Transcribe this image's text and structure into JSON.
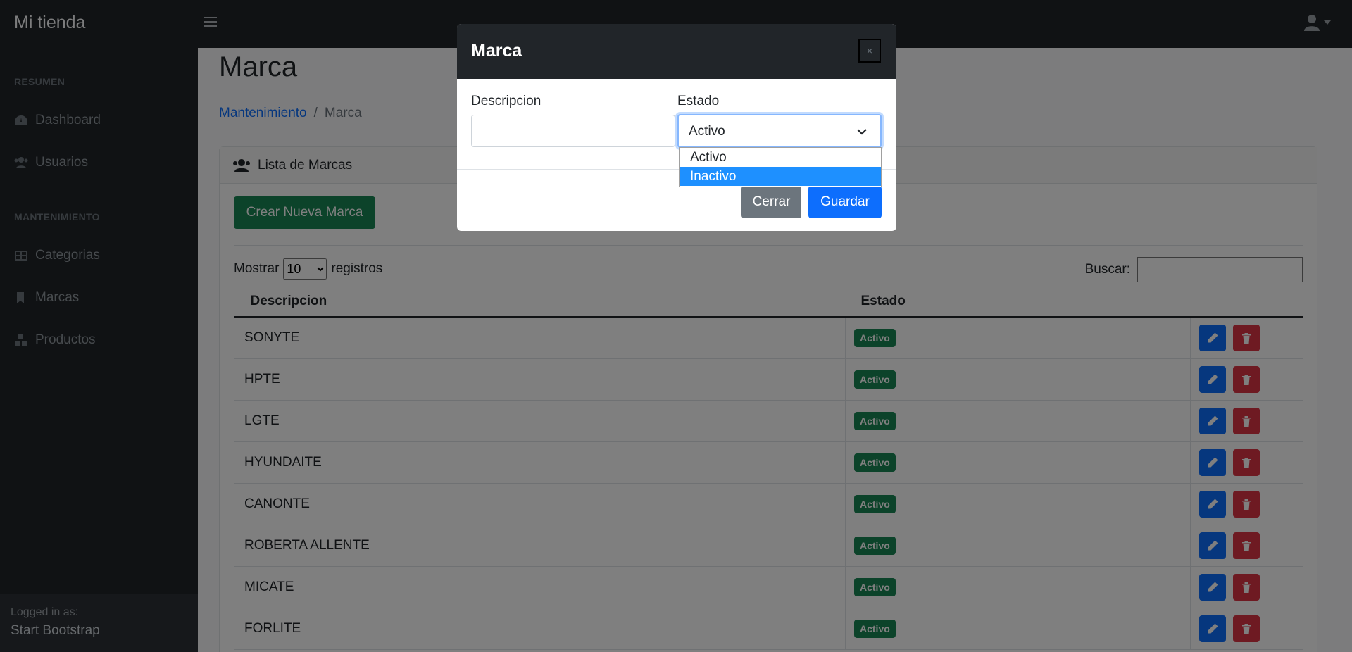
{
  "navbar": {
    "brand": "Mi tienda"
  },
  "sidebar": {
    "heading_resumen": "RESUMEN",
    "heading_mantenimiento": "MANTENIMIENTO",
    "items": [
      {
        "label": "Dashboard",
        "icon": "tachometer-icon"
      },
      {
        "label": "Usuarios",
        "icon": "users-icon"
      },
      {
        "label": "Categorias",
        "icon": "table-icon"
      },
      {
        "label": "Marcas",
        "icon": "bookmark-icon"
      },
      {
        "label": "Productos",
        "icon": "boxes-icon"
      }
    ],
    "footer": {
      "logged_in_label": "Logged in as:",
      "user": "Start Bootstrap"
    }
  },
  "page": {
    "title": "Marca",
    "breadcrumb": {
      "parent": "Mantenimiento",
      "separator": "/",
      "current": "Marca"
    },
    "card_title": "Lista de Marcas",
    "new_button": "Crear Nueva Marca",
    "length": {
      "prefix": "Mostrar",
      "value": "10",
      "suffix": "registros"
    },
    "search_label": "Buscar:"
  },
  "table": {
    "columns": [
      "Descripcion",
      "Estado",
      ""
    ],
    "rows": [
      {
        "descripcion": "SONYTE",
        "estado": "Activo"
      },
      {
        "descripcion": "HPTE",
        "estado": "Activo"
      },
      {
        "descripcion": "LGTE",
        "estado": "Activo"
      },
      {
        "descripcion": "HYUNDAITE",
        "estado": "Activo"
      },
      {
        "descripcion": "CANONTE",
        "estado": "Activo"
      },
      {
        "descripcion": "ROBERTA ALLENTE",
        "estado": "Activo"
      },
      {
        "descripcion": "MICATE",
        "estado": "Activo"
      },
      {
        "descripcion": "FORLITE",
        "estado": "Activo"
      }
    ]
  },
  "modal": {
    "title": "Marca",
    "close_symbol": "×",
    "descripcion_label": "Descripcion",
    "descripcion_value": "",
    "estado_label": "Estado",
    "estado_value": "Activo",
    "estado_options": [
      "Activo",
      "Inactivo"
    ],
    "highlighted_option": "Inactivo",
    "cerrar_button": "Cerrar",
    "guardar_button": "Guardar"
  },
  "colors": {
    "dark": "#212529",
    "success": "#198754",
    "primary": "#0d6efd",
    "danger": "#dc3545",
    "secondary": "#6c757d",
    "dropdown_highlight": "#1e90ff"
  }
}
